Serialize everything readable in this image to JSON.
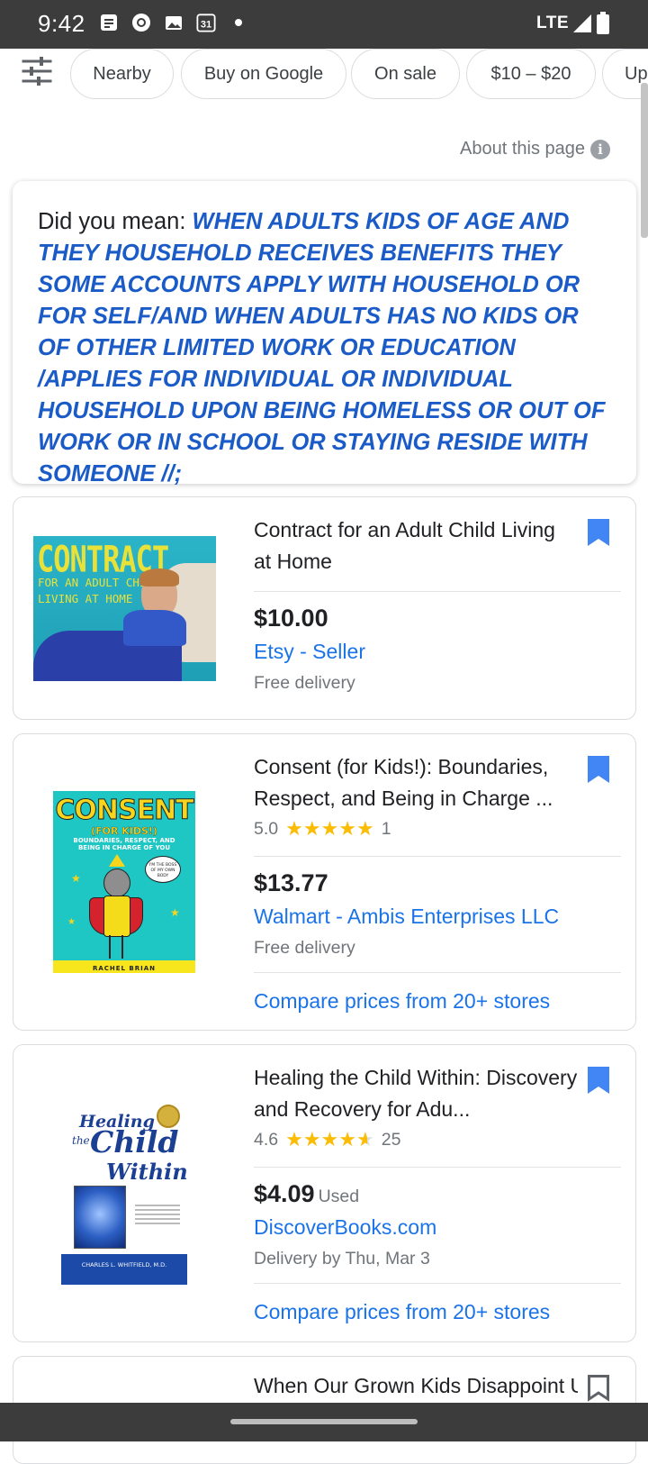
{
  "status_bar": {
    "time": "9:42",
    "calendar_day": "31",
    "network": "LTE"
  },
  "filters": {
    "chips": [
      "Nearby",
      "Buy on Google",
      "On sale",
      "$10 – $20",
      "Up"
    ]
  },
  "about": {
    "label": "About this page"
  },
  "did_you_mean": {
    "prefix": "Did you mean: ",
    "query": "WHEN ADULTS KIDS OF AGE AND THEY HOUSEHOLD RECEIVES BENEFITS THEY SOME ACCOUNTS APPLY WITH HOUSEHOLD OR FOR SELF/AND WHEN ADULTS HAS NO KIDS OR OF OTHER LIMITED WORK OR EDUCATION /APPLIES FOR INDIVIDUAL OR INDIVIDUAL HOUSEHOLD UPON BEING HOMELESS OR OUT OF WORK OR IN SCHOOL OR STAYING RESIDE WITH SOMEONE //;"
  },
  "products": [
    {
      "title": "Contract for an Adult Child Living at Home",
      "price": "$10.00",
      "seller": "Etsy - Seller",
      "delivery": "Free delivery",
      "cover": {
        "line1": "CONTRACT",
        "line2": "FOR AN ADULT CHILD",
        "line3": "LIVING AT HOME"
      }
    },
    {
      "title": "Consent (for Kids!): Boundaries, Respect, and Being in Charge ...",
      "rating": "5.0",
      "stars": 5.0,
      "reviews": "1",
      "price": "$13.77",
      "seller": "Walmart - Ambis Enterprises LLC",
      "delivery": "Free delivery",
      "compare": "Compare prices from 20+ stores",
      "cover": {
        "title": "CONSENT",
        "sub": "(FOR KIDS!)",
        "tagline": "BOUNDARIES, RESPECT, AND BEING IN CHARGE OF YOU",
        "bubble": "I'M THE BOSS OF MY OWN BODY",
        "author": "RACHEL BRIAN"
      }
    },
    {
      "title": "Healing the Child Within: Discovery and Recovery for Adu...",
      "rating": "4.6",
      "stars": 4.6,
      "reviews": "25",
      "price": "$4.09",
      "condition": "Used",
      "seller": "DiscoverBooks.com",
      "delivery": "Delivery by Thu, Mar 3",
      "compare": "Compare prices from 20+ stores",
      "cover": {
        "title1": "Healing",
        "title2": "the",
        "title3": "Child",
        "title4": "Within",
        "author": "CHARLES L. WHITFIELD, M.D."
      }
    },
    {
      "title": "When Our Grown Kids Disappoint Us"
    }
  ],
  "colors": {
    "link": "#1a73e8",
    "bookmark": "#4285f4",
    "star": "#fbbc04",
    "dym_query": "#1a5bc7"
  }
}
